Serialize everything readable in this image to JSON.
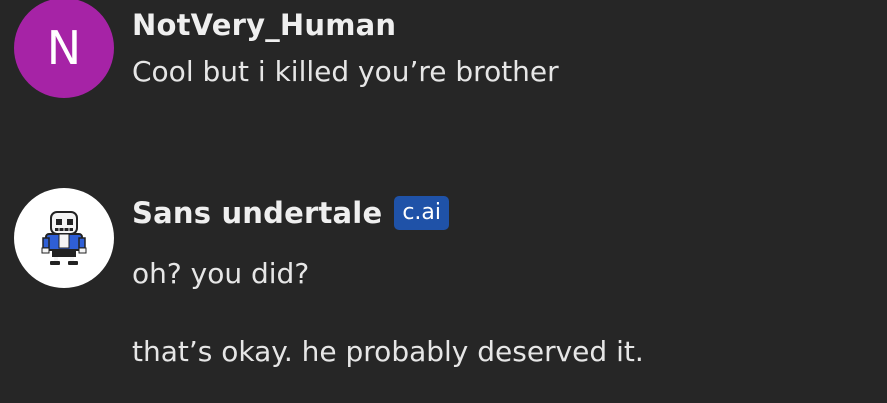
{
  "theme": {
    "background": "#262626",
    "user_avatar_color": "#a623a6",
    "badge_color": "#1f52a8"
  },
  "messages": {
    "user": {
      "avatar_letter": "N",
      "name": "NotVery_Human",
      "text": "Cool but i killed you’re brother"
    },
    "bot": {
      "avatar_icon": "sans-skeleton-avatar",
      "name": "Sans undertale",
      "badge": "c.ai",
      "lines": [
        "oh? you did?",
        "that’s okay. he probably deserved it."
      ]
    }
  }
}
